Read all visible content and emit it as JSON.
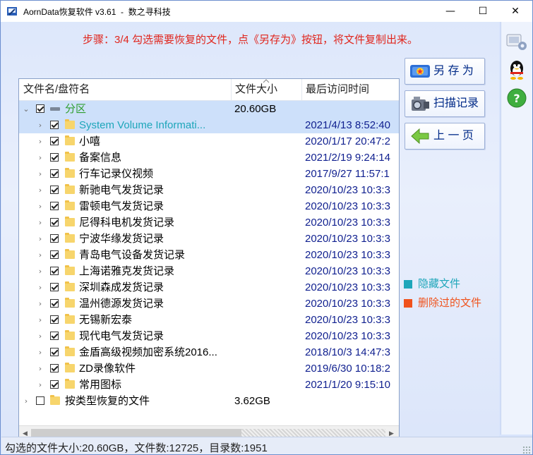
{
  "window": {
    "title": "AornData恢复软件 v3.61  -  数之寻科技",
    "minimize_glyph": "—",
    "maximize_glyph": "☐",
    "close_glyph": "✕"
  },
  "step_text": "步骤：3/4 勾选需要恢复的文件，点《另存为》按钮，将文件复制出来。",
  "table": {
    "columns": [
      "文件名/盘符名",
      "文件大小",
      "最后访问时间"
    ],
    "rows": [
      {
        "name": "分区",
        "size": "20.60GB",
        "time": ""
      },
      {
        "name": "System Volume Informati...",
        "size": "",
        "time": "2021/4/13 8:52:40"
      },
      {
        "name": "小嘻",
        "size": "",
        "time": "2020/1/17 20:47:2"
      },
      {
        "name": "备案信息",
        "size": "",
        "time": "2021/2/19 9:24:14"
      },
      {
        "name": "行车记录仪视频",
        "size": "",
        "time": "2017/9/27 11:57:1"
      },
      {
        "name": "新驰电气发货记录",
        "size": "",
        "time": "2020/10/23 10:3:3"
      },
      {
        "name": "雷顿电气发货记录",
        "size": "",
        "time": "2020/10/23 10:3:3"
      },
      {
        "name": "尼得科电机发货记录",
        "size": "",
        "time": "2020/10/23 10:3:3"
      },
      {
        "name": "宁波华缘发货记录",
        "size": "",
        "time": "2020/10/23 10:3:3"
      },
      {
        "name": "青岛电气设备发货记录",
        "size": "",
        "time": "2020/10/23 10:3:3"
      },
      {
        "name": "上海诺雅克发货记录",
        "size": "",
        "time": "2020/10/23 10:3:3"
      },
      {
        "name": "深圳森成发货记录",
        "size": "",
        "time": "2020/10/23 10:3:3"
      },
      {
        "name": "温州德源发货记录",
        "size": "",
        "time": "2020/10/23 10:3:3"
      },
      {
        "name": "无锡新宏泰",
        "size": "",
        "time": "2020/10/23 10:3:3"
      },
      {
        "name": "现代电气发货记录",
        "size": "",
        "time": "2020/10/23 10:3:3"
      },
      {
        "name": "金盾高级视频加密系统2016...",
        "size": "",
        "time": "2018/10/3 14:47:3"
      },
      {
        "name": "ZD录像软件",
        "size": "",
        "time": "2019/6/30 10:18:2"
      },
      {
        "name": "常用图标",
        "size": "",
        "time": "2021/1/20 9:15:10"
      },
      {
        "name": "按类型恢复的文件",
        "size": "3.62GB",
        "time": ""
      }
    ]
  },
  "buttons": {
    "save_as": "另 存 为",
    "scan_record": "扫描记录",
    "prev_page": "上 一 页"
  },
  "legend": {
    "hidden_files": "隐藏文件",
    "deleted_files": "删除过的文件",
    "hidden_color": "#1ea6ba",
    "deleted_color": "#f0521c"
  },
  "status": "勾选的文件大小:20.60GB，文件数:12725，目录数:1951",
  "icons": [
    "app-icon",
    "settings-icon",
    "qq-penguin-icon",
    "help-icon",
    "folder-icon",
    "save-icon",
    "camera-icon",
    "back-arrow-icon"
  ]
}
